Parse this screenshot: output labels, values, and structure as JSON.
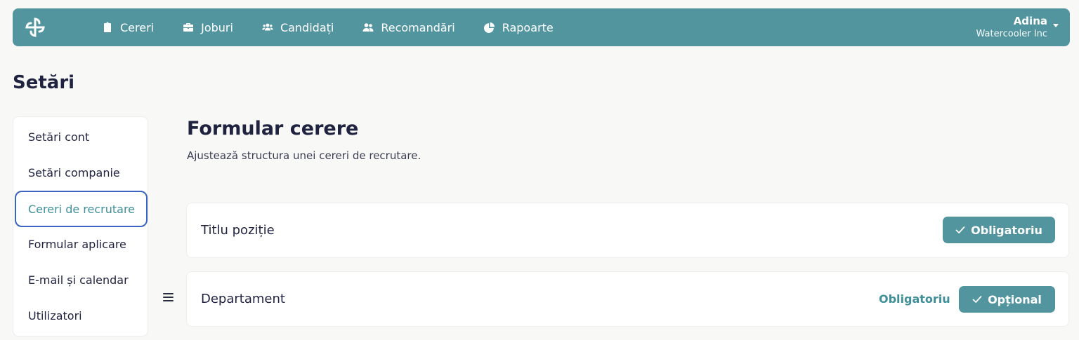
{
  "nav": {
    "logo_icon": "pinwheel-logo-icon",
    "items": [
      {
        "label": "Cereri",
        "icon": "clipboard-icon"
      },
      {
        "label": "Joburi",
        "icon": "briefcase-icon"
      },
      {
        "label": "Candidați",
        "icon": "users-group-icon"
      },
      {
        "label": "Recomandări",
        "icon": "user-friends-icon"
      },
      {
        "label": "Rapoarte",
        "icon": "pie-chart-icon"
      }
    ],
    "user": {
      "name": "Adina",
      "org": "Watercooler Inc"
    }
  },
  "page": {
    "title": "Setări"
  },
  "sidebar": {
    "items": [
      {
        "label": "Setări cont"
      },
      {
        "label": "Setări companie"
      },
      {
        "label": "Cereri de recrutare",
        "active": true
      },
      {
        "label": "Formular aplicare"
      },
      {
        "label": "E-mail și calendar"
      },
      {
        "label": "Utilizatori"
      }
    ]
  },
  "main": {
    "title": "Formular cerere",
    "subtitle": "Ajustează structura unei cereri de recrutare.",
    "fields": [
      {
        "label": "Titlu poziție",
        "selected": "Obligatoriu"
      },
      {
        "label": "Departament",
        "option_link": "Obligatoriu",
        "selected": "Opțional"
      }
    ]
  },
  "colors": {
    "accent": "#52959f",
    "active_text": "#3e8f98",
    "focus_border": "#3a63c4"
  }
}
